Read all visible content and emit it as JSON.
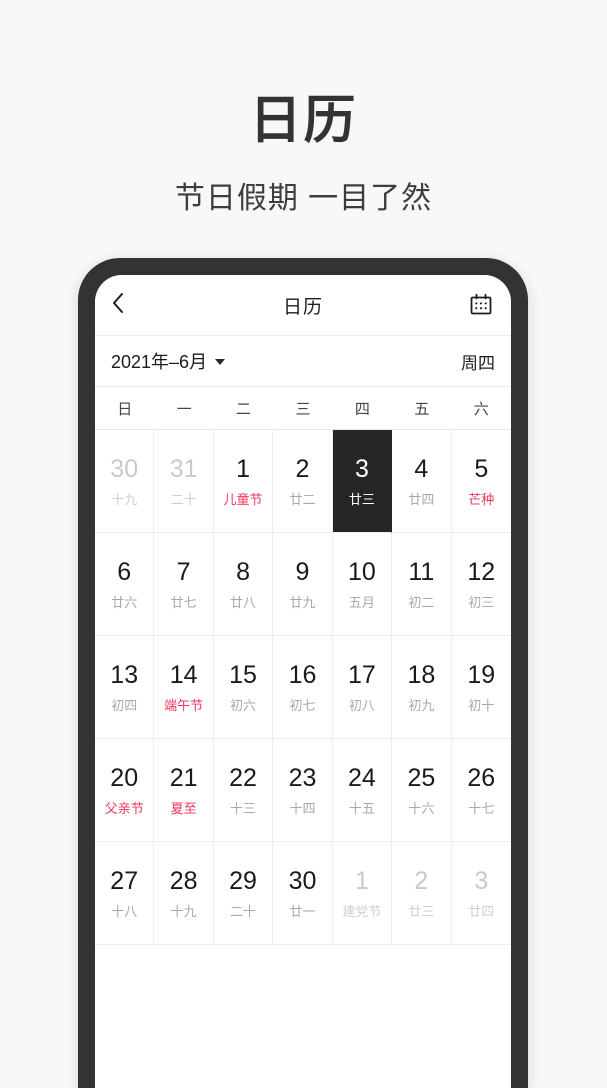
{
  "promo": {
    "title": "日历",
    "subtitle": "节日假期  一目了然"
  },
  "app": {
    "navbar": {
      "back_icon": "chevron-left-icon",
      "title": "日历",
      "calendar_icon": "calendar-icon"
    },
    "month_bar": {
      "month_label": "2021年–6月",
      "caret_icon": "chevron-down-icon",
      "weekday_label": "周四"
    },
    "weekday_headers": [
      "日",
      "一",
      "二",
      "三",
      "四",
      "五",
      "六"
    ],
    "colors": {
      "festival_red": "#f0365a",
      "selected_bg": "#262628",
      "lunar_grey": "#a9a9a9",
      "out_of_month_grey": "#c9c9c9",
      "bezel": "#333333",
      "page_bg": "#f8f8f8"
    },
    "days": [
      {
        "num": "30",
        "lunar": "十九",
        "out": true,
        "fest": false,
        "selected": false
      },
      {
        "num": "31",
        "lunar": "二十",
        "out": true,
        "fest": false,
        "selected": false
      },
      {
        "num": "1",
        "lunar": "儿童节",
        "out": false,
        "fest": true,
        "selected": false
      },
      {
        "num": "2",
        "lunar": "廿二",
        "out": false,
        "fest": false,
        "selected": false
      },
      {
        "num": "3",
        "lunar": "廿三",
        "out": false,
        "fest": false,
        "selected": true
      },
      {
        "num": "4",
        "lunar": "廿四",
        "out": false,
        "fest": false,
        "selected": false
      },
      {
        "num": "5",
        "lunar": "芒种",
        "out": false,
        "fest": true,
        "selected": false
      },
      {
        "num": "6",
        "lunar": "廿六",
        "out": false,
        "fest": false,
        "selected": false
      },
      {
        "num": "7",
        "lunar": "廿七",
        "out": false,
        "fest": false,
        "selected": false
      },
      {
        "num": "8",
        "lunar": "廿八",
        "out": false,
        "fest": false,
        "selected": false
      },
      {
        "num": "9",
        "lunar": "廿九",
        "out": false,
        "fest": false,
        "selected": false
      },
      {
        "num": "10",
        "lunar": "五月",
        "out": false,
        "fest": false,
        "selected": false
      },
      {
        "num": "11",
        "lunar": "初二",
        "out": false,
        "fest": false,
        "selected": false
      },
      {
        "num": "12",
        "lunar": "初三",
        "out": false,
        "fest": false,
        "selected": false
      },
      {
        "num": "13",
        "lunar": "初四",
        "out": false,
        "fest": false,
        "selected": false
      },
      {
        "num": "14",
        "lunar": "端午节",
        "out": false,
        "fest": true,
        "selected": false
      },
      {
        "num": "15",
        "lunar": "初六",
        "out": false,
        "fest": false,
        "selected": false
      },
      {
        "num": "16",
        "lunar": "初七",
        "out": false,
        "fest": false,
        "selected": false
      },
      {
        "num": "17",
        "lunar": "初八",
        "out": false,
        "fest": false,
        "selected": false
      },
      {
        "num": "18",
        "lunar": "初九",
        "out": false,
        "fest": false,
        "selected": false
      },
      {
        "num": "19",
        "lunar": "初十",
        "out": false,
        "fest": false,
        "selected": false
      },
      {
        "num": "20",
        "lunar": "父亲节",
        "out": false,
        "fest": true,
        "selected": false
      },
      {
        "num": "21",
        "lunar": "夏至",
        "out": false,
        "fest": true,
        "selected": false
      },
      {
        "num": "22",
        "lunar": "十三",
        "out": false,
        "fest": false,
        "selected": false
      },
      {
        "num": "23",
        "lunar": "十四",
        "out": false,
        "fest": false,
        "selected": false
      },
      {
        "num": "24",
        "lunar": "十五",
        "out": false,
        "fest": false,
        "selected": false
      },
      {
        "num": "25",
        "lunar": "十六",
        "out": false,
        "fest": false,
        "selected": false
      },
      {
        "num": "26",
        "lunar": "十七",
        "out": false,
        "fest": false,
        "selected": false
      },
      {
        "num": "27",
        "lunar": "十八",
        "out": false,
        "fest": false,
        "selected": false
      },
      {
        "num": "28",
        "lunar": "十九",
        "out": false,
        "fest": false,
        "selected": false
      },
      {
        "num": "29",
        "lunar": "二十",
        "out": false,
        "fest": false,
        "selected": false
      },
      {
        "num": "30",
        "lunar": "廿一",
        "out": false,
        "fest": false,
        "selected": false
      },
      {
        "num": "1",
        "lunar": "建党节",
        "out": true,
        "fest": true,
        "selected": false
      },
      {
        "num": "2",
        "lunar": "廿三",
        "out": true,
        "fest": false,
        "selected": false
      },
      {
        "num": "3",
        "lunar": "廿四",
        "out": true,
        "fest": false,
        "selected": false
      }
    ]
  }
}
